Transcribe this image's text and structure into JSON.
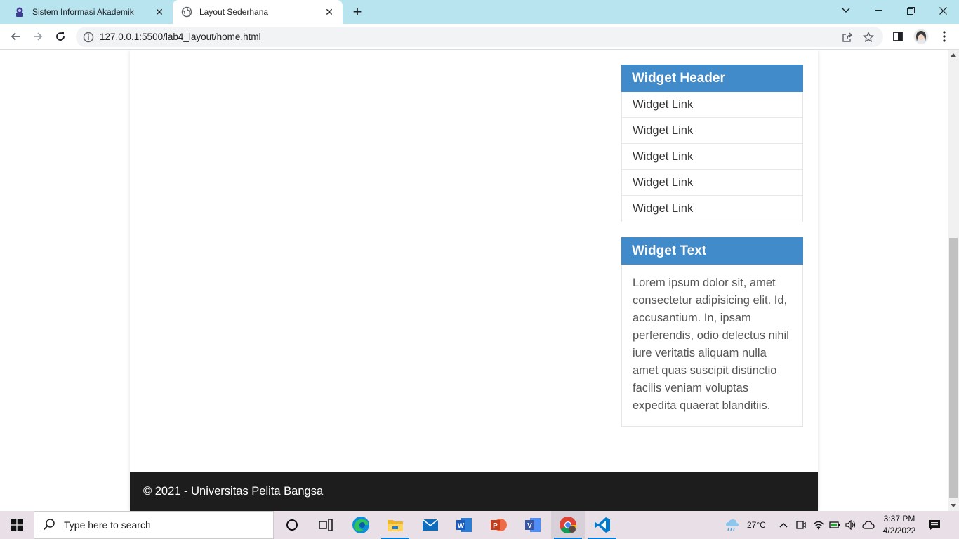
{
  "browser": {
    "tabs": [
      {
        "title": "Sistem Informasi Akademik",
        "active": false
      },
      {
        "title": "Layout Sederhana",
        "active": true
      }
    ],
    "url": "127.0.0.1:5500/lab4_layout/home.html"
  },
  "sidebar": {
    "widget_links": {
      "header": "Widget Header",
      "links": [
        "Widget Link",
        "Widget Link",
        "Widget Link",
        "Widget Link",
        "Widget Link"
      ]
    },
    "widget_text": {
      "header": "Widget Text",
      "body": "Lorem ipsum dolor sit, amet consectetur adipisicing elit. Id, accusantium. In, ipsam perferendis, odio delectus nihil iure veritatis aliquam nulla amet quas suscipit distinctio facilis veniam voluptas expedita quaerat blanditiis."
    }
  },
  "footer": {
    "text": "© 2021 - Universitas Pelita Bangsa"
  },
  "taskbar": {
    "search_placeholder": "Type here to search",
    "weather": "27°C",
    "time": "3:37 PM",
    "date": "4/2/2022"
  },
  "colors": {
    "widget_header": "#428bca",
    "footer_bg": "#1d1d1d",
    "tabstrip": "#b8e4f0"
  }
}
